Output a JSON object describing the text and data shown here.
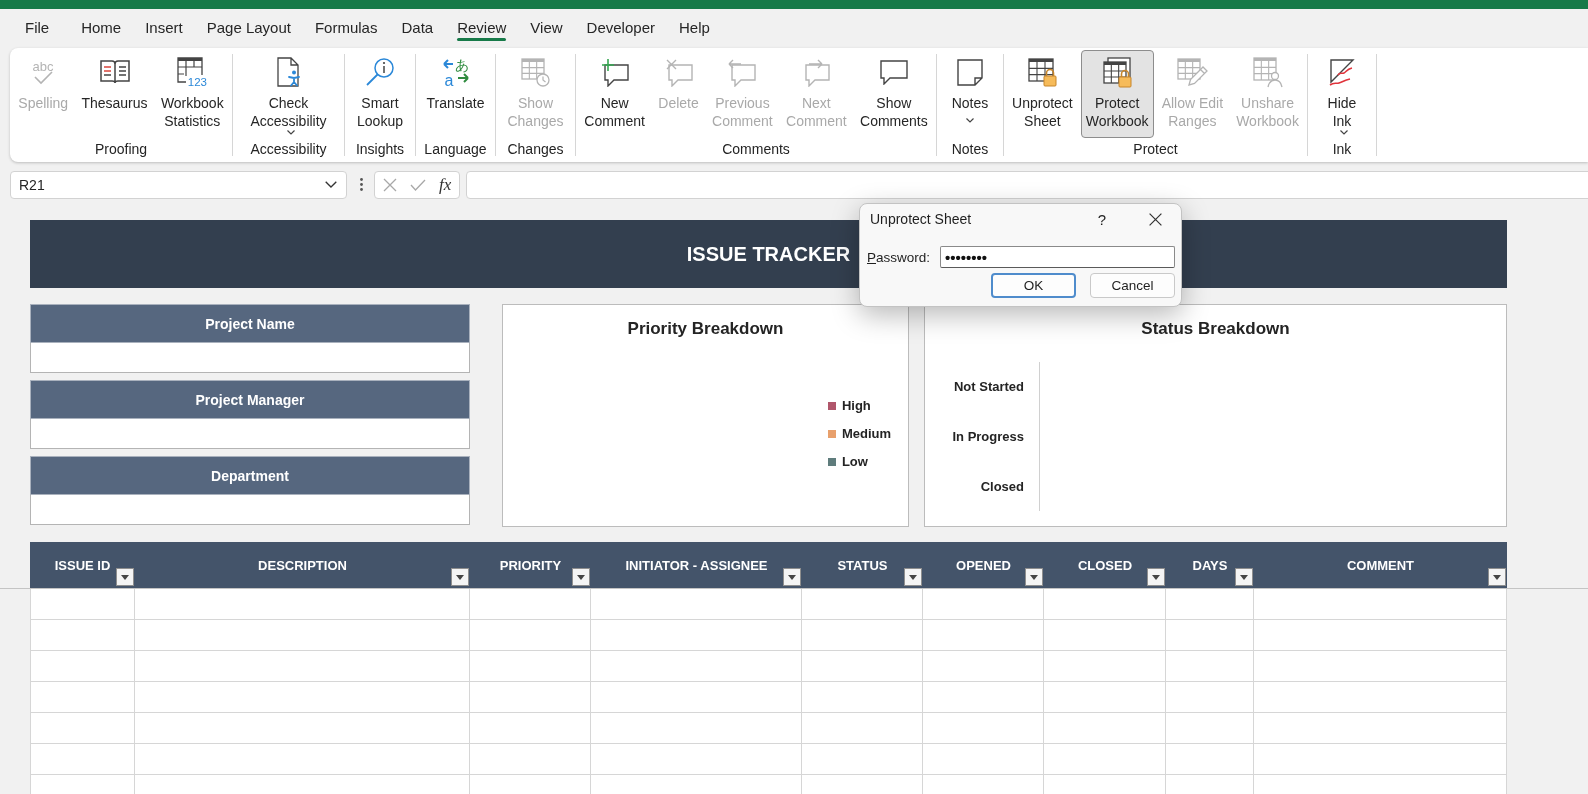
{
  "menu_tabs": [
    {
      "label": "File",
      "selected": false
    },
    {
      "label": "Home",
      "selected": false
    },
    {
      "label": "Insert",
      "selected": false
    },
    {
      "label": "Page Layout",
      "selected": false
    },
    {
      "label": "Formulas",
      "selected": false
    },
    {
      "label": "Data",
      "selected": false
    },
    {
      "label": "Review",
      "selected": true
    },
    {
      "label": "View",
      "selected": false
    },
    {
      "label": "Developer",
      "selected": false
    },
    {
      "label": "Help",
      "selected": false
    }
  ],
  "ribbon": {
    "groups": [
      {
        "label": "Proofing",
        "buttons": [
          {
            "kind": "spelling",
            "label": "Spelling",
            "icon_text": [
              "abc"
            ],
            "disabled": true,
            "pressed": false,
            "dropdown": false
          },
          {
            "kind": "thesaurus",
            "label": "Thesaurus",
            "disabled": false,
            "pressed": false,
            "dropdown": false
          },
          {
            "kind": "statistics",
            "label": "Workbook\nStatistics",
            "icon_text": [
              "123"
            ],
            "disabled": false,
            "pressed": false,
            "dropdown": false
          }
        ]
      },
      {
        "label": "Accessibility",
        "buttons": [
          {
            "kind": "accessibility",
            "label": "Check\nAccessibility",
            "disabled": false,
            "pressed": false,
            "dropdown": true
          }
        ]
      },
      {
        "label": "Insights",
        "buttons": [
          {
            "kind": "lookup",
            "label": "Smart\nLookup",
            "disabled": false,
            "pressed": false,
            "dropdown": false
          }
        ]
      },
      {
        "label": "Language",
        "buttons": [
          {
            "kind": "translate",
            "label": "Translate",
            "icon_text": [
              "あ",
              "a"
            ],
            "disabled": false,
            "pressed": false,
            "dropdown": false
          }
        ]
      },
      {
        "label": "Changes",
        "buttons": [
          {
            "kind": "changes",
            "label": "Show\nChanges",
            "disabled": true,
            "pressed": false,
            "dropdown": false
          }
        ]
      },
      {
        "label": "Comments",
        "buttons": [
          {
            "kind": "newcomment",
            "label": "New\nComment",
            "disabled": false,
            "pressed": false,
            "dropdown": false
          },
          {
            "kind": "deletecomment",
            "label": "Delete",
            "disabled": true,
            "pressed": false,
            "dropdown": false
          },
          {
            "kind": "prevcomment",
            "label": "Previous\nComment",
            "disabled": true,
            "pressed": false,
            "dropdown": false
          },
          {
            "kind": "nextcomment",
            "label": "Next\nComment",
            "disabled": true,
            "pressed": false,
            "dropdown": false
          },
          {
            "kind": "comments",
            "label": "Show\nComments",
            "disabled": false,
            "pressed": false,
            "dropdown": false
          }
        ]
      },
      {
        "label": "Notes",
        "buttons": [
          {
            "kind": "notes",
            "label": "Notes",
            "disabled": false,
            "pressed": false,
            "dropdown": true
          }
        ]
      },
      {
        "label": "Protect",
        "buttons": [
          {
            "kind": "unprotect",
            "label": "Unprotect\nSheet",
            "disabled": false,
            "pressed": false,
            "dropdown": false
          },
          {
            "kind": "protectworkbook",
            "label": "Protect\nWorkbook",
            "disabled": false,
            "pressed": true,
            "dropdown": false
          },
          {
            "kind": "alloweditranges",
            "label": "Allow Edit\nRanges",
            "disabled": true,
            "pressed": false,
            "dropdown": false
          },
          {
            "kind": "unshare",
            "label": "Unshare\nWorkbook",
            "disabled": true,
            "pressed": false,
            "dropdown": false
          }
        ]
      },
      {
        "label": "Ink",
        "buttons": [
          {
            "kind": "ink",
            "label": "Hide\nInk",
            "disabled": false,
            "pressed": false,
            "dropdown": true
          }
        ]
      }
    ]
  },
  "formula_bar": {
    "name_box": "R21",
    "function_label": "fx"
  },
  "sheet": {
    "title": "ISSUE TRACKER",
    "info_fields": [
      {
        "label": "Project Name"
      },
      {
        "label": "Project Manager"
      },
      {
        "label": "Department"
      }
    ],
    "priority_chart": {
      "title": "Priority Breakdown",
      "legend": [
        {
          "label": "High",
          "color": "#b0566b"
        },
        {
          "label": "Medium",
          "color": "#e8a06c"
        },
        {
          "label": "Low",
          "color": "#5f7c7c"
        }
      ]
    },
    "status_chart": {
      "title": "Status Breakdown",
      "categories": [
        "Not Started",
        "In Progress",
        "Closed"
      ]
    },
    "table": {
      "columns": [
        {
          "label": "ISSUE ID",
          "filter": true
        },
        {
          "label": "DESCRIPTION",
          "filter": true
        },
        {
          "label": "PRIORITY",
          "filter": true
        },
        {
          "label": "INITIATOR - ASSIGNEE",
          "filter": true
        },
        {
          "label": "STATUS",
          "filter": true
        },
        {
          "label": "OPENED",
          "filter": true
        },
        {
          "label": "CLOSED",
          "filter": true
        },
        {
          "label": "DAYS",
          "filter": true
        },
        {
          "label": "COMMENT",
          "filter": true
        }
      ]
    }
  },
  "dialog": {
    "title": "Unprotect Sheet",
    "help": "?",
    "password_label": "Password:",
    "password_value": "••••••••",
    "buttons": [
      {
        "label": "OK",
        "default": true
      },
      {
        "label": "Cancel",
        "default": false
      }
    ]
  }
}
